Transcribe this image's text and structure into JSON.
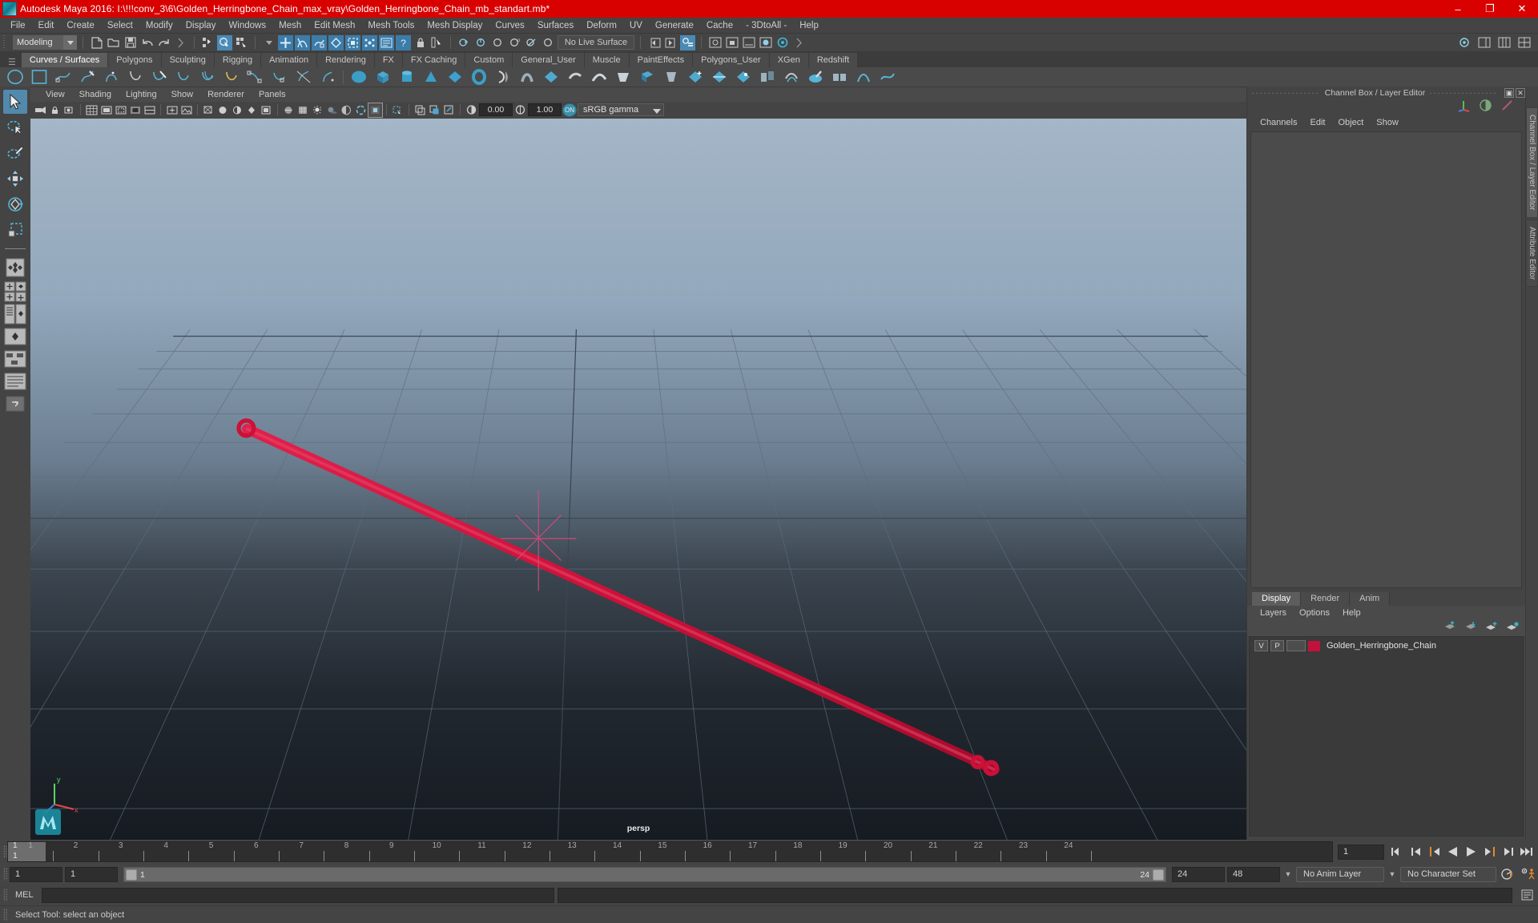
{
  "window": {
    "title": "Autodesk Maya 2016: I:\\!!!conv_3\\6\\Golden_Herringbone_Chain_max_vray\\Golden_Herringbone_Chain_mb_standart.mb*",
    "minimize": "–",
    "maximize": "❐",
    "close": "✕",
    "titlebar_color": "#d90000"
  },
  "menubar": {
    "items": [
      "File",
      "Edit",
      "Create",
      "Select",
      "Modify",
      "Display",
      "Windows",
      "Mesh",
      "Edit Mesh",
      "Mesh Tools",
      "Mesh Display",
      "Curves",
      "Surfaces",
      "Deform",
      "UV",
      "Generate",
      "Cache",
      "- 3DtoAll -",
      "Help"
    ]
  },
  "statusline": {
    "menuset": "Modeling",
    "live_surface": "No Live Surface"
  },
  "shelf": {
    "tabs": [
      "Curves / Surfaces",
      "Polygons",
      "Sculpting",
      "Rigging",
      "Animation",
      "Rendering",
      "FX",
      "FX Caching",
      "Custom",
      "General_User",
      "Muscle",
      "PaintEffects",
      "Polygons_User",
      "XGen",
      "Redshift"
    ],
    "active_tab": "Curves / Surfaces"
  },
  "viewport": {
    "menus": [
      "View",
      "Shading",
      "Lighting",
      "Show",
      "Renderer",
      "Panels"
    ],
    "exposure": "0.00",
    "gamma": "1.00",
    "color_management": "sRGB gamma",
    "camera_label": "persp",
    "object_color": "#cc1038"
  },
  "channelbox": {
    "caption": "Channel Box / Layer Editor",
    "menus": [
      "Channels",
      "Edit",
      "Object",
      "Show"
    ]
  },
  "layer_editor": {
    "tabs": [
      "Display",
      "Render",
      "Anim"
    ],
    "active_tab": "Display",
    "menus": [
      "Layers",
      "Options",
      "Help"
    ],
    "layers": [
      {
        "visible": "V",
        "playback": "P",
        "color": "#c3113d",
        "name": "Golden_Herringbone_Chain"
      }
    ]
  },
  "vertical_tabs": [
    "Channel Box / Layer Editor",
    "Attribute Editor"
  ],
  "timeline": {
    "ticks": [
      "1",
      "2",
      "3",
      "4",
      "5",
      "6",
      "7",
      "8",
      "9",
      "10",
      "11",
      "12",
      "13",
      "14",
      "15",
      "16",
      "17",
      "18",
      "19",
      "20",
      "21",
      "22",
      "23",
      "24"
    ],
    "current_frame_marker": "1",
    "current_frame_field": "1"
  },
  "range": {
    "start": "1",
    "playback_start": "1",
    "range_start_label": "1",
    "range_end_label": "24",
    "playback_end": "24",
    "end": "48",
    "anim_layer": "No Anim Layer",
    "character_set": "No Character Set"
  },
  "command_line": {
    "label": "MEL",
    "value": "",
    "output": ""
  },
  "status": {
    "message": "Select Tool: select an object"
  },
  "icons": {
    "new_scene": "new-scene-icon",
    "open_scene": "open-scene-icon",
    "save_scene": "save-scene-icon",
    "undo": "undo-icon",
    "redo": "redo-icon",
    "select_tool": "select-tool-icon",
    "lasso_tool": "lasso-select-icon",
    "paint_select": "paint-select-icon",
    "move_tool": "move-tool-icon",
    "rotate_tool": "rotate-tool-icon",
    "scale_tool": "scale-tool-icon"
  }
}
